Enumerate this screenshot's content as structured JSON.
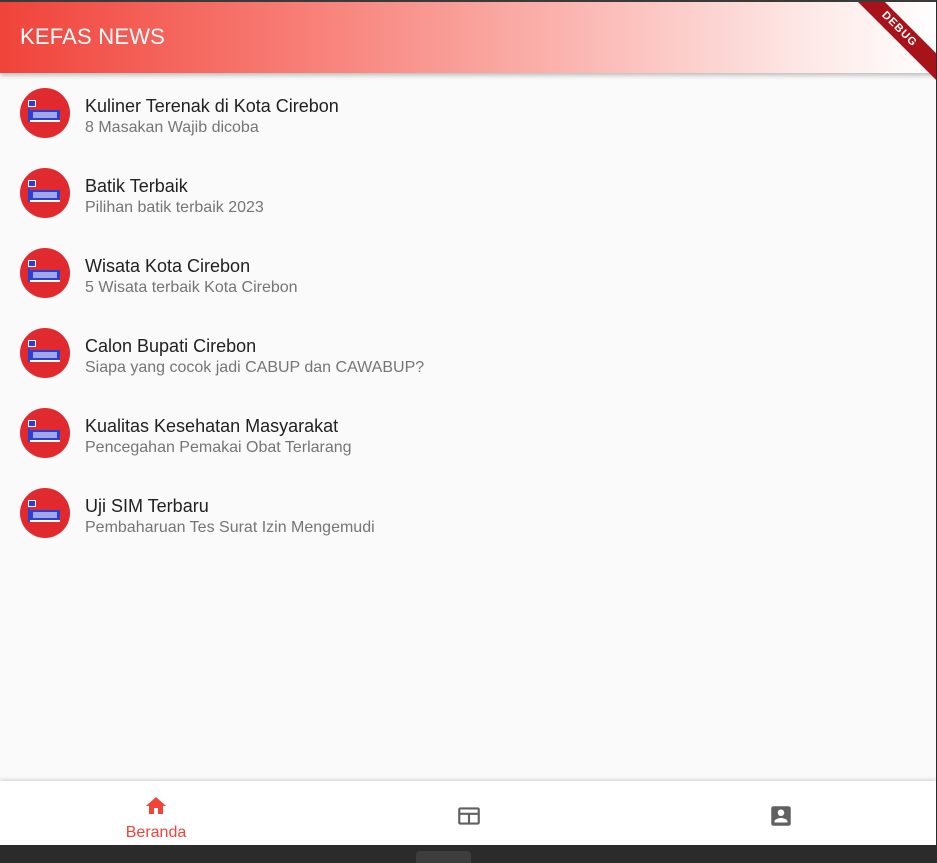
{
  "app": {
    "title": "KEFAS NEWS",
    "debug_label": "DEBUG"
  },
  "colors": {
    "accent": "#f0433a",
    "avatar_bg": "#e02a2e",
    "nav_inactive": "#616161"
  },
  "news": [
    {
      "title": "Kuliner Terenak di Kota Cirebon",
      "subtitle": "8 Masakan Wajib dicoba",
      "icon": "news-logo"
    },
    {
      "title": "Batik Terbaik",
      "subtitle": "Pilihan batik terbaik 2023",
      "icon": "news-logo"
    },
    {
      "title": "Wisata Kota Cirebon",
      "subtitle": "5 Wisata terbaik Kota Cirebon",
      "icon": "news-logo"
    },
    {
      "title": "Calon Bupati Cirebon",
      "subtitle": "Siapa yang cocok jadi CABUP dan CAWABUP?",
      "icon": "news-logo"
    },
    {
      "title": "Kualitas Kesehatan Masyarakat",
      "subtitle": "Pencegahan Pemakai Obat Terlarang",
      "icon": "news-logo"
    },
    {
      "title": "Uji SIM Terbaru",
      "subtitle": "Pembaharuan Tes Surat Izin Mengemudi",
      "icon": "news-logo"
    }
  ],
  "bottom_nav": {
    "items": [
      {
        "label": "Beranda",
        "icon": "home-icon",
        "active": true
      },
      {
        "label": "",
        "icon": "newspaper-icon",
        "active": false
      },
      {
        "label": "",
        "icon": "account-box-icon",
        "active": false
      }
    ]
  }
}
